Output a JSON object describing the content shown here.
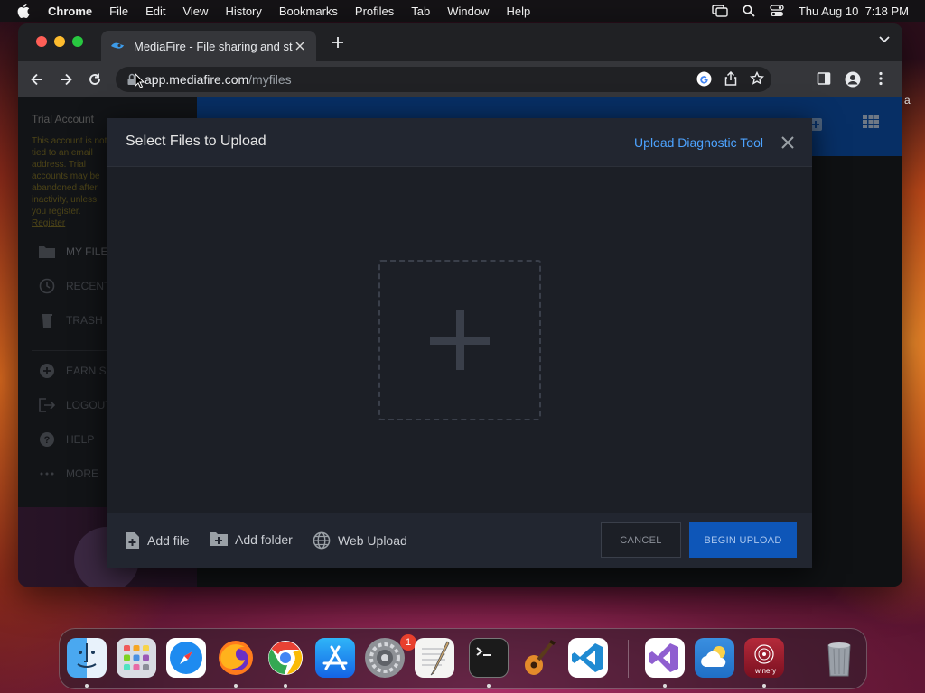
{
  "menubar": {
    "app": "Chrome",
    "items": [
      "File",
      "Edit",
      "View",
      "History",
      "Bookmarks",
      "Profiles",
      "Tab",
      "Window",
      "Help"
    ],
    "datetime": "Thu Aug 10  7:18 PM"
  },
  "browser": {
    "tab_title": "MediaFire - File sharing and sto",
    "url_host": "app.mediafire.com",
    "url_path": "/myfiles"
  },
  "sidebar": {
    "trial_title": "Trial Account",
    "trial_note": "This account is not tied to an email address. Trial accounts may be abandoned after inactivity, unless you register.",
    "register_label": "Register",
    "items": [
      {
        "label": "MY FILES",
        "icon": "folder-icon"
      },
      {
        "label": "RECENT",
        "icon": "clock-icon"
      },
      {
        "label": "TRASH",
        "icon": "trash-icon"
      },
      {
        "label": "EARN SPACE",
        "icon": "plus-circle-icon"
      },
      {
        "label": "LOGOUT",
        "icon": "logout-icon"
      },
      {
        "label": "HELP",
        "icon": "help-icon"
      },
      {
        "label": "MORE",
        "icon": "more-icon"
      }
    ]
  },
  "modal": {
    "title": "Select Files to Upload",
    "diagnostic_link": "Upload Diagnostic Tool",
    "add_file": "Add file",
    "add_folder": "Add folder",
    "web_upload": "Web Upload",
    "cancel": "CANCEL",
    "begin_upload": "BEGIN UPLOAD"
  },
  "edge_text": "a",
  "dock": {
    "apps": [
      "Finder",
      "Launchpad",
      "Safari",
      "Firefox",
      "Chrome",
      "App Store",
      "System Settings",
      "TextEdit",
      "Terminal",
      "GarageBand",
      "Visual Studio Code",
      "Visual Studio",
      "Weather",
      "Winery",
      "Trash"
    ],
    "system_settings_badge": "1",
    "winery_label": "winery"
  },
  "colors": {
    "accent_blue": "#0e56b8",
    "link_blue": "#4da3ff",
    "modal_bg": "#1c1f26"
  }
}
